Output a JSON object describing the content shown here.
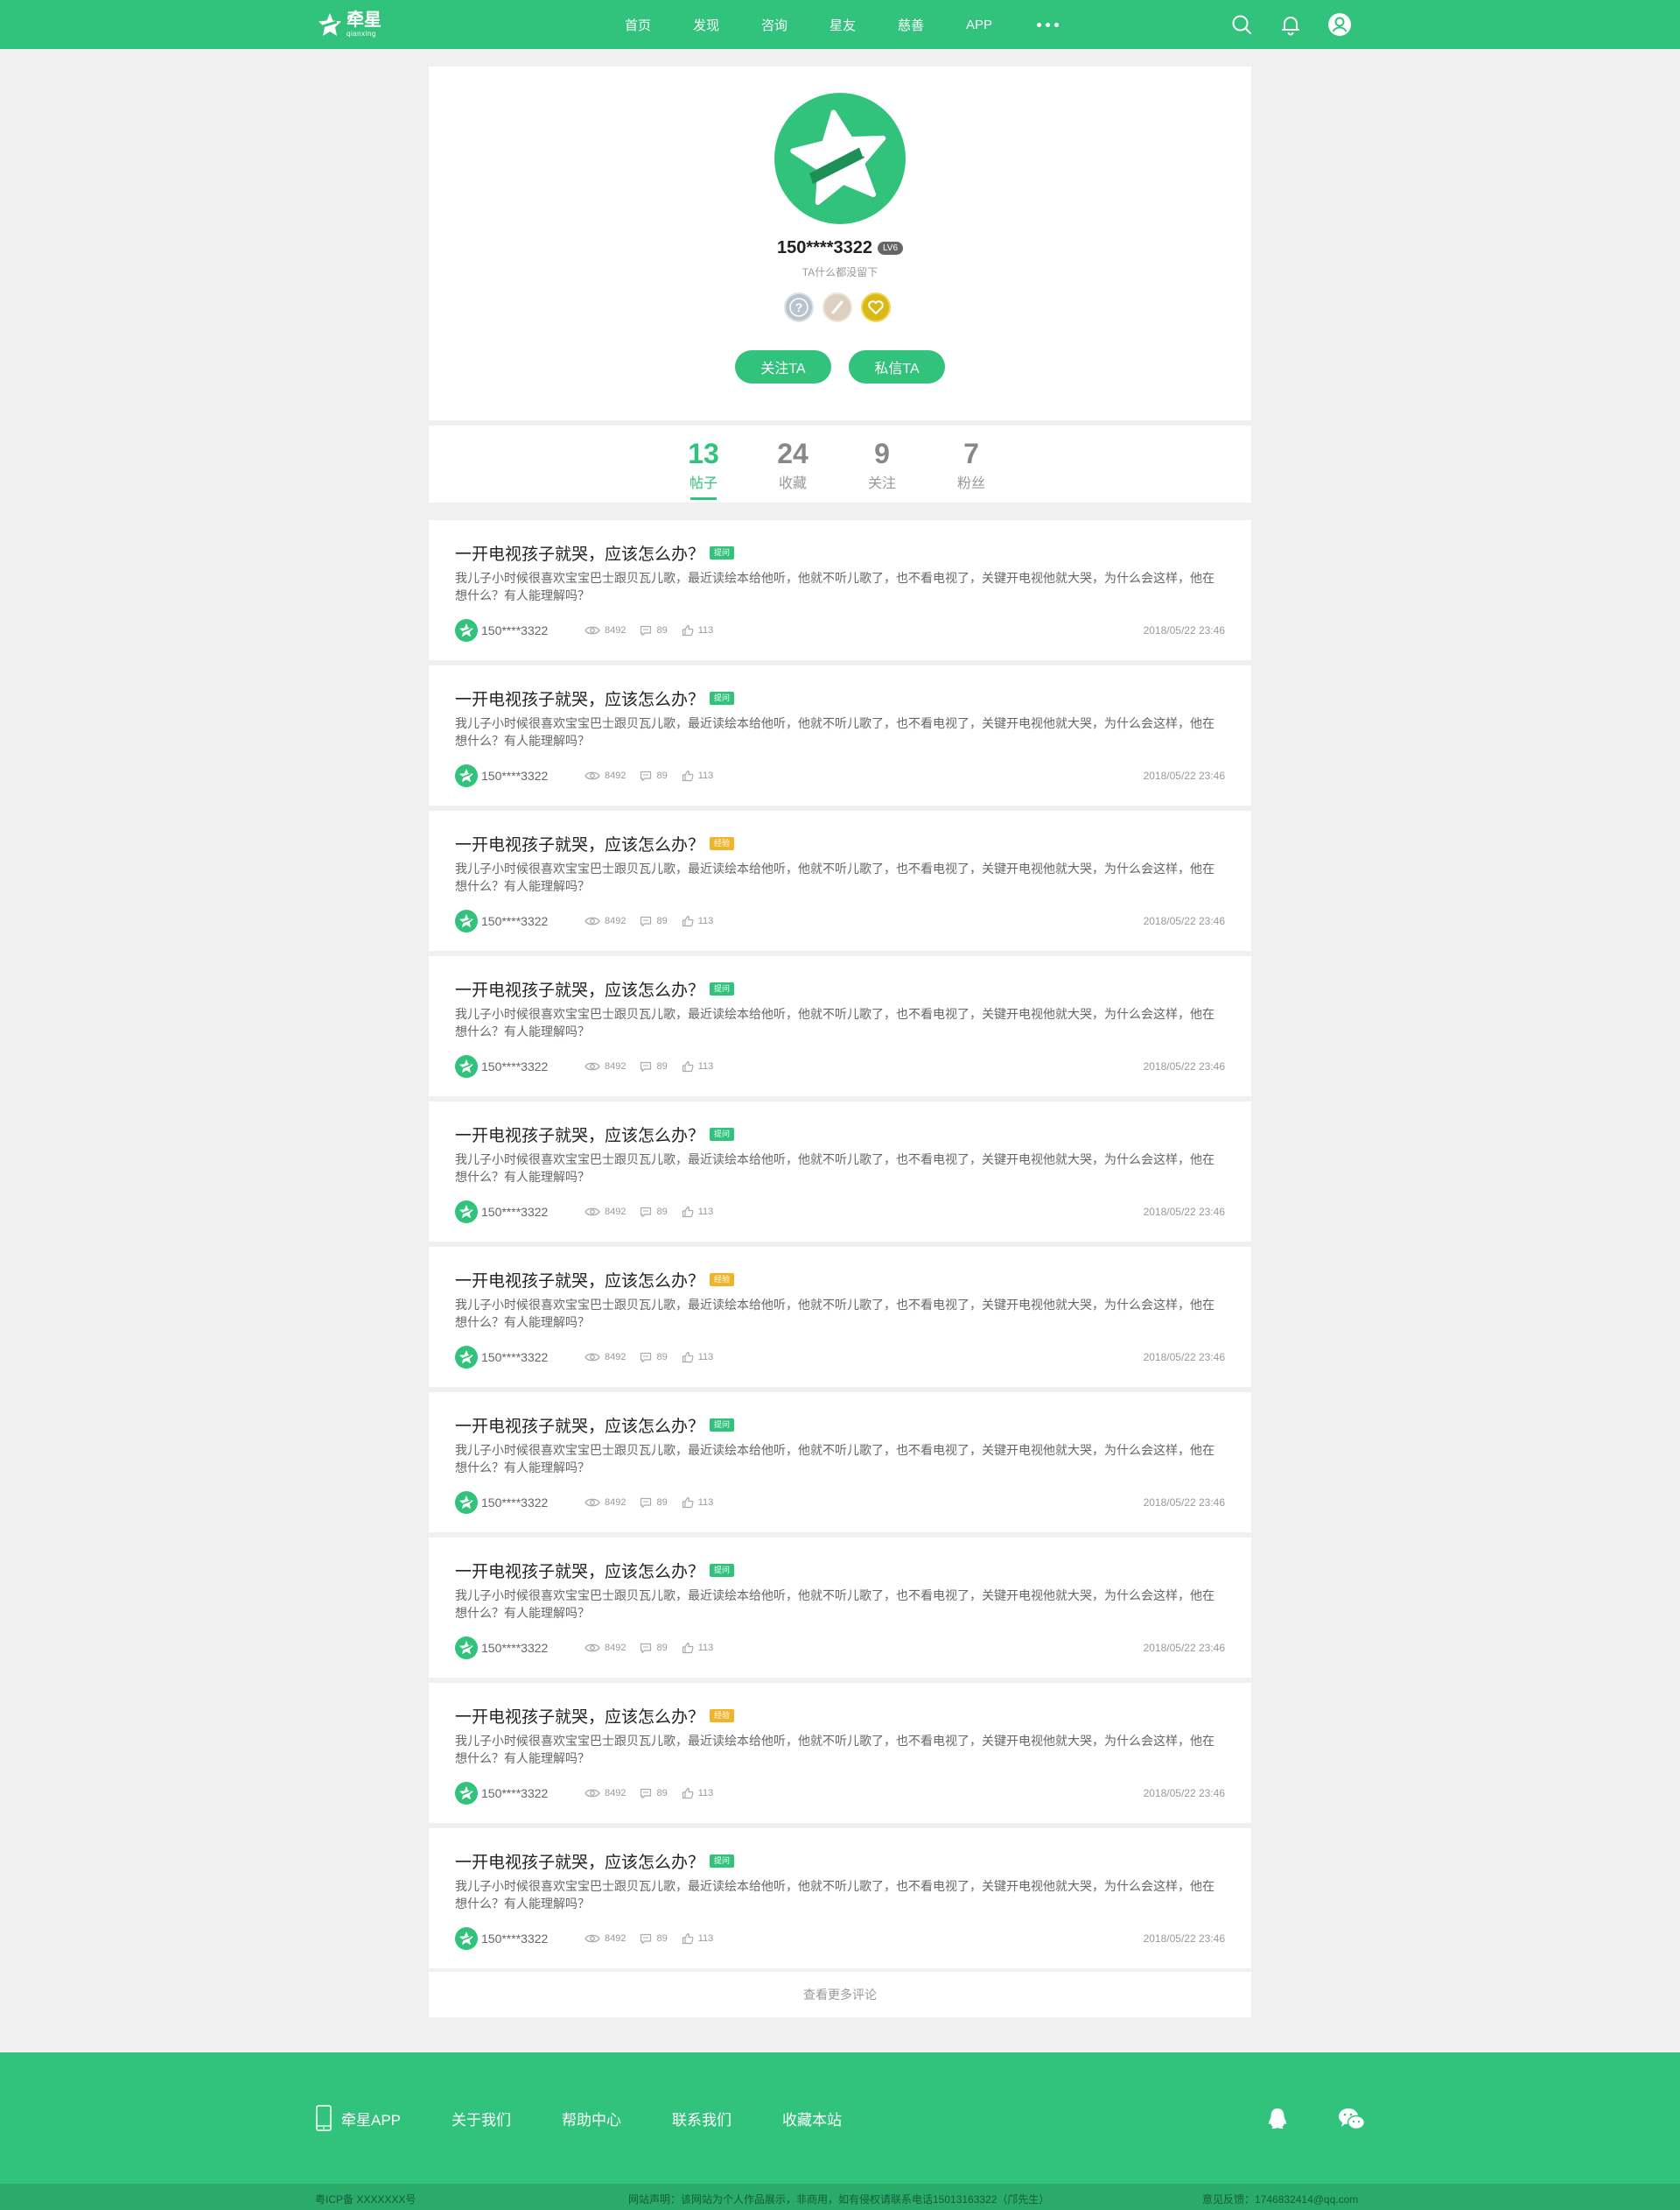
{
  "nav": {
    "logo_cn": "牵星",
    "logo_en": "qianxing",
    "items": [
      "首页",
      "发现",
      "咨询",
      "星友",
      "慈善",
      "APP"
    ]
  },
  "profile": {
    "name": "150****3322",
    "level": "LV6",
    "bio": "TA什么都没留下",
    "medals": [
      "question-medal-icon",
      "pen-medal-icon",
      "heart-medal-icon"
    ],
    "follow_label": "关注TA",
    "message_label": "私信TA"
  },
  "stats": [
    {
      "num": "13",
      "label": "帖子",
      "active": true
    },
    {
      "num": "24",
      "label": "收藏",
      "active": false
    },
    {
      "num": "9",
      "label": "关注",
      "active": false
    },
    {
      "num": "7",
      "label": "粉丝",
      "active": false
    }
  ],
  "posts": [
    {
      "title": "一开电视孩子就哭，应该怎么办？",
      "tag": "提问",
      "tag_color": "#31c27c",
      "body": "我儿子小时候很喜欢宝宝巴士跟贝瓦儿歌，最近读绘本给他听，他就不听儿歌了，也不看电视了，关键开电视他就大哭，为什么会这样，他在想什么？有人能理解吗？",
      "user": "150****3322",
      "views": "8492",
      "comments": "89",
      "likes": "113",
      "date": "2018/05/22  23:46"
    },
    {
      "title": "一开电视孩子就哭，应该怎么办？",
      "tag": "提问",
      "tag_color": "#31c27c",
      "body": "我儿子小时候很喜欢宝宝巴士跟贝瓦儿歌，最近读绘本给他听，他就不听儿歌了，也不看电视了，关键开电视他就大哭，为什么会这样，他在想什么？有人能理解吗？",
      "user": "150****3322",
      "views": "8492",
      "comments": "89",
      "likes": "113",
      "date": "2018/05/22  23:46"
    },
    {
      "title": "一开电视孩子就哭，应该怎么办？",
      "tag": "经验",
      "tag_color": "#f0b429",
      "body": "我儿子小时候很喜欢宝宝巴士跟贝瓦儿歌，最近读绘本给他听，他就不听儿歌了，也不看电视了，关键开电视他就大哭，为什么会这样，他在想什么？有人能理解吗？",
      "user": "150****3322",
      "views": "8492",
      "comments": "89",
      "likes": "113",
      "date": "2018/05/22  23:46"
    },
    {
      "title": "一开电视孩子就哭，应该怎么办？",
      "tag": "提问",
      "tag_color": "#31c27c",
      "body": "我儿子小时候很喜欢宝宝巴士跟贝瓦儿歌，最近读绘本给他听，他就不听儿歌了，也不看电视了，关键开电视他就大哭，为什么会这样，他在想什么？有人能理解吗？",
      "user": "150****3322",
      "views": "8492",
      "comments": "89",
      "likes": "113",
      "date": "2018/05/22  23:46"
    },
    {
      "title": "一开电视孩子就哭，应该怎么办？",
      "tag": "提问",
      "tag_color": "#31c27c",
      "body": "我儿子小时候很喜欢宝宝巴士跟贝瓦儿歌，最近读绘本给他听，他就不听儿歌了，也不看电视了，关键开电视他就大哭，为什么会这样，他在想什么？有人能理解吗？",
      "user": "150****3322",
      "views": "8492",
      "comments": "89",
      "likes": "113",
      "date": "2018/05/22  23:46"
    },
    {
      "title": "一开电视孩子就哭，应该怎么办？",
      "tag": "经验",
      "tag_color": "#f0b429",
      "body": "我儿子小时候很喜欢宝宝巴士跟贝瓦儿歌，最近读绘本给他听，他就不听儿歌了，也不看电视了，关键开电视他就大哭，为什么会这样，他在想什么？有人能理解吗？",
      "user": "150****3322",
      "views": "8492",
      "comments": "89",
      "likes": "113",
      "date": "2018/05/22  23:46"
    },
    {
      "title": "一开电视孩子就哭，应该怎么办？",
      "tag": "提问",
      "tag_color": "#31c27c",
      "body": "我儿子小时候很喜欢宝宝巴士跟贝瓦儿歌，最近读绘本给他听，他就不听儿歌了，也不看电视了，关键开电视他就大哭，为什么会这样，他在想什么？有人能理解吗？",
      "user": "150****3322",
      "views": "8492",
      "comments": "89",
      "likes": "113",
      "date": "2018/05/22  23:46"
    },
    {
      "title": "一开电视孩子就哭，应该怎么办？",
      "tag": "提问",
      "tag_color": "#31c27c",
      "body": "我儿子小时候很喜欢宝宝巴士跟贝瓦儿歌，最近读绘本给他听，他就不听儿歌了，也不看电视了，关键开电视他就大哭，为什么会这样，他在想什么？有人能理解吗？",
      "user": "150****3322",
      "views": "8492",
      "comments": "89",
      "likes": "113",
      "date": "2018/05/22  23:46"
    },
    {
      "title": "一开电视孩子就哭，应该怎么办？",
      "tag": "经验",
      "tag_color": "#f0b429",
      "body": "我儿子小时候很喜欢宝宝巴士跟贝瓦儿歌，最近读绘本给他听，他就不听儿歌了，也不看电视了，关键开电视他就大哭，为什么会这样，他在想什么？有人能理解吗？",
      "user": "150****3322",
      "views": "8492",
      "comments": "89",
      "likes": "113",
      "date": "2018/05/22  23:46"
    },
    {
      "title": "一开电视孩子就哭，应该怎么办？",
      "tag": "提问",
      "tag_color": "#31c27c",
      "body": "我儿子小时候很喜欢宝宝巴士跟贝瓦儿歌，最近读绘本给他听，他就不听儿歌了，也不看电视了，关键开电视他就大哭，为什么会这样，他在想什么？有人能理解吗？",
      "user": "150****3322",
      "views": "8492",
      "comments": "89",
      "likes": "113",
      "date": "2018/05/22  23:46"
    }
  ],
  "more_label": "查看更多评论",
  "footer": {
    "links": [
      "牵星APP",
      "关于我们",
      "帮助中心",
      "联系我们",
      "收藏本站"
    ],
    "icp": "粤ICP备 XXXXXXX号",
    "notice": "网站声明：该网站为个人作品展示，非商用，如有侵权请联系电话15013163322（邝先生）",
    "feedback": "意见反馈：1746832414@qq.com"
  },
  "colors": {
    "brand": "#31c27c",
    "tag_question": "#31c27c",
    "tag_experience": "#f0b429"
  }
}
